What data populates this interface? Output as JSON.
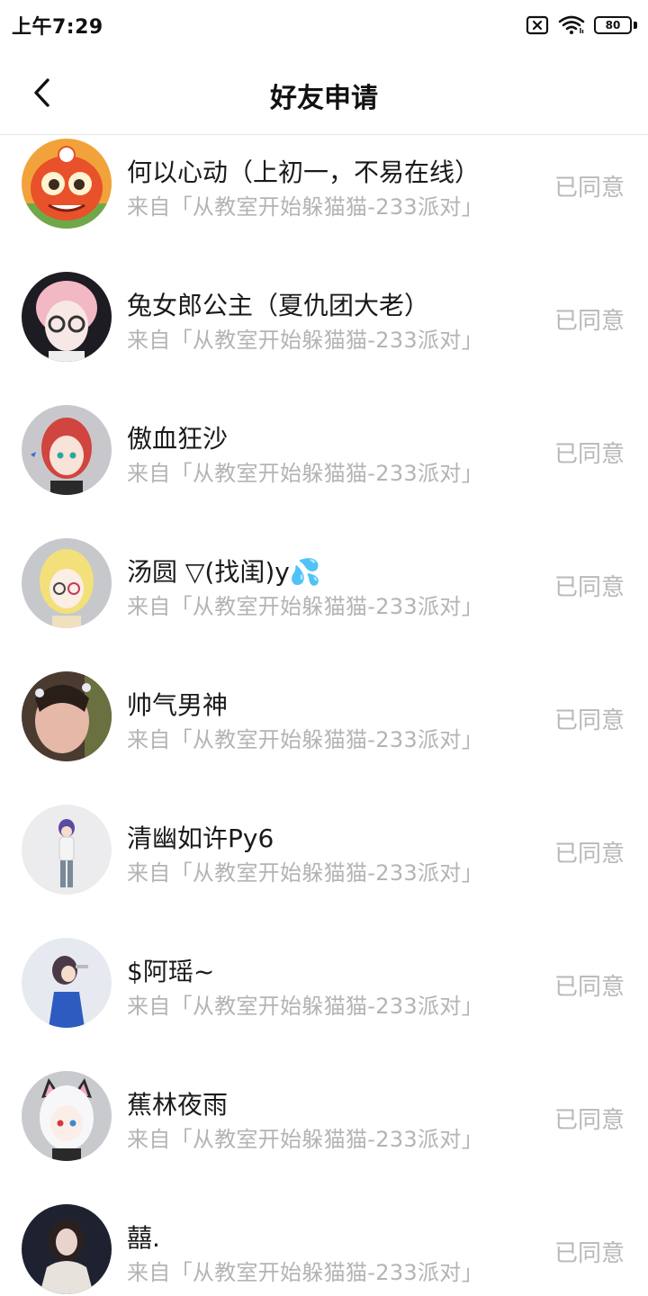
{
  "status_bar": {
    "time": "上午7:29",
    "battery": "80"
  },
  "header": {
    "title": "好友申请"
  },
  "colors": {
    "accent_text": "#1a1a1a",
    "secondary_text": "#b4b4b4",
    "status_text": "#b8b8b8",
    "divider": "#e6e6e6"
  },
  "requests": [
    {
      "name": "何以心动（上初一，不易在线）",
      "source": "来自「从教室开始躲猫猫-233派对」",
      "status": "已同意",
      "avatar": "orange-dragon-avatar"
    },
    {
      "name": "兔女郎公主（夏仇团大老）",
      "source": "来自「从教室开始躲猫猫-233派对」",
      "status": "已同意",
      "avatar": "pink-hair-glasses-avatar"
    },
    {
      "name": "傲血狂沙",
      "source": "来自「从教室开始躲猫猫-233派对」",
      "status": "已同意",
      "avatar": "red-hair-girl-avatar"
    },
    {
      "name": "汤圆 ▽(找闺)y💦",
      "source": "来自「从教室开始躲猫猫-233派对」",
      "status": "已同意",
      "avatar": "blonde-glasses-avatar"
    },
    {
      "name": "帅气男神",
      "source": "来自「从教室开始躲猫猫-233派对」",
      "status": "已同意",
      "avatar": "child-photo-avatar"
    },
    {
      "name": "清幽如许Py6",
      "source": "来自「从教室开始躲猫猫-233派对」",
      "status": "已同意",
      "avatar": "purple-hair-figure-avatar"
    },
    {
      "name": "$阿瑶~",
      "source": "来自「从教室开始躲猫猫-233派对」",
      "status": "已同意",
      "avatar": "dark-hair-figure-avatar"
    },
    {
      "name": "蕉林夜雨",
      "source": "来自「从教室开始躲猫猫-233派对」",
      "status": "已同意",
      "avatar": "cat-ear-girl-avatar"
    },
    {
      "name": "囍.",
      "source": "来自「从教室开始躲猫猫-233派对」",
      "status": "已同意",
      "avatar": "dark-photo-avatar"
    }
  ]
}
